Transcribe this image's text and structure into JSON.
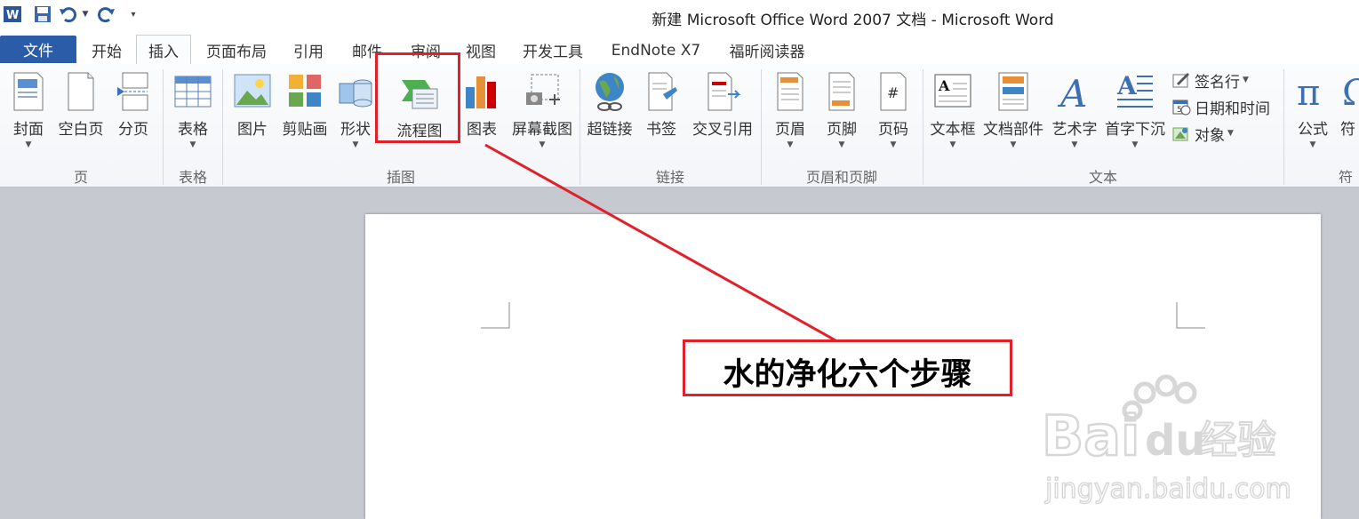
{
  "window": {
    "title": "新建 Microsoft Office Word 2007 文档 - Microsoft Word"
  },
  "tabs": [
    "文件",
    "开始",
    "插入",
    "页面布局",
    "引用",
    "邮件",
    "审阅",
    "视图",
    "开发工具",
    "EndNote X7",
    "福昕阅读器"
  ],
  "active_tab": "插入",
  "groups": {
    "page": {
      "label": "页",
      "buttons": [
        "封面",
        "空白页",
        "分页"
      ]
    },
    "table": {
      "label": "表格",
      "buttons": [
        "表格"
      ]
    },
    "illustrations": {
      "label": "插图",
      "buttons": [
        "图片",
        "剪贴画",
        "形状",
        "流程图",
        "图表",
        "屏幕截图"
      ]
    },
    "links": {
      "label": "链接",
      "buttons": [
        "超链接",
        "书签",
        "交叉引用"
      ]
    },
    "header_footer": {
      "label": "页眉和页脚",
      "buttons": [
        "页眉",
        "页脚",
        "页码"
      ]
    },
    "text": {
      "label": "文本",
      "buttons": [
        "文本框",
        "文档部件",
        "艺术字",
        "首字下沉"
      ],
      "small_items": [
        "签名行",
        "日期和时间",
        "对象"
      ]
    },
    "symbols": {
      "label": "符",
      "buttons": [
        "公式",
        "符"
      ]
    }
  },
  "document": {
    "headline": "水的净化六个步骤"
  },
  "watermark": {
    "brand": "Bai",
    "brand2": "du",
    "cn": "经验",
    "url": "jingyan.baidu.com"
  },
  "colors": {
    "file_tab": "#2b5ca8",
    "annotation_red": "#e0202a",
    "ribbon_bg": "#f3f5f8",
    "workspace": "#c6cad0"
  }
}
